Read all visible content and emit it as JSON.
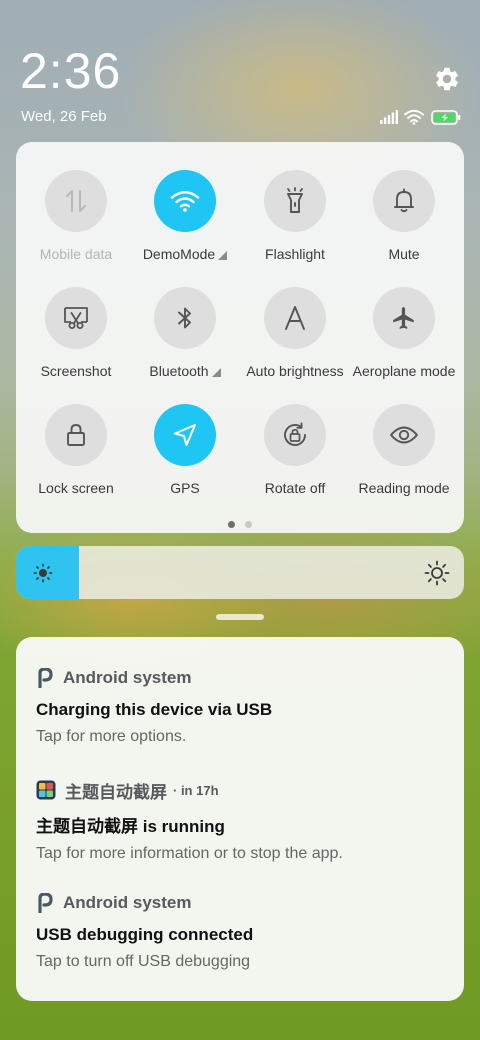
{
  "status": {
    "time": "2:36",
    "date": "Wed, 26 Feb",
    "icons": [
      "signal-icon",
      "wifi-icon",
      "battery-charging-icon"
    ]
  },
  "quick_settings": {
    "tiles": [
      {
        "label": "Mobile data",
        "icon": "mobile-data-icon",
        "active": false,
        "disabled": true,
        "expandable": false
      },
      {
        "label": "DemoMode",
        "icon": "wifi-icon",
        "active": true,
        "disabled": false,
        "expandable": true
      },
      {
        "label": "Flashlight",
        "icon": "flashlight-icon",
        "active": false,
        "disabled": false,
        "expandable": false
      },
      {
        "label": "Mute",
        "icon": "bell-icon",
        "active": false,
        "disabled": false,
        "expandable": false
      },
      {
        "label": "Screenshot",
        "icon": "screenshot-icon",
        "active": false,
        "disabled": false,
        "expandable": false
      },
      {
        "label": "Bluetooth",
        "icon": "bluetooth-icon",
        "active": false,
        "disabled": false,
        "expandable": true
      },
      {
        "label": "Auto brightness",
        "icon": "auto-brightness-icon",
        "active": false,
        "disabled": false,
        "expandable": false
      },
      {
        "label": "Aeroplane mode",
        "icon": "airplane-icon",
        "active": false,
        "disabled": false,
        "expandable": false
      },
      {
        "label": "Lock screen",
        "icon": "lock-icon",
        "active": false,
        "disabled": false,
        "expandable": false
      },
      {
        "label": "GPS",
        "icon": "location-icon",
        "active": true,
        "disabled": false,
        "expandable": false
      },
      {
        "label": "Rotate off",
        "icon": "rotate-lock-icon",
        "active": false,
        "disabled": false,
        "expandable": false
      },
      {
        "label": "Reading mode",
        "icon": "eye-icon",
        "active": false,
        "disabled": false,
        "expandable": false
      }
    ],
    "page_count": 2,
    "current_page": 1
  },
  "brightness": {
    "level": 0.14
  },
  "colors": {
    "accent": "#1fc6f4",
    "tile_off": "#dedede"
  },
  "notifications": [
    {
      "app": "Android system",
      "when": "",
      "icon": "android-system-icon",
      "title": "Charging this device via USB",
      "text": "Tap for more options."
    },
    {
      "app": "主题自动截屏",
      "when": "· in 17h",
      "icon": "theme-screenshot-app-icon",
      "title": "主题自动截屏 is running",
      "text": "Tap for more information or to stop the app."
    },
    {
      "app": "Android system",
      "when": "",
      "icon": "android-system-icon",
      "title": "USB debugging connected",
      "text": "Tap to turn off USB debugging"
    }
  ]
}
